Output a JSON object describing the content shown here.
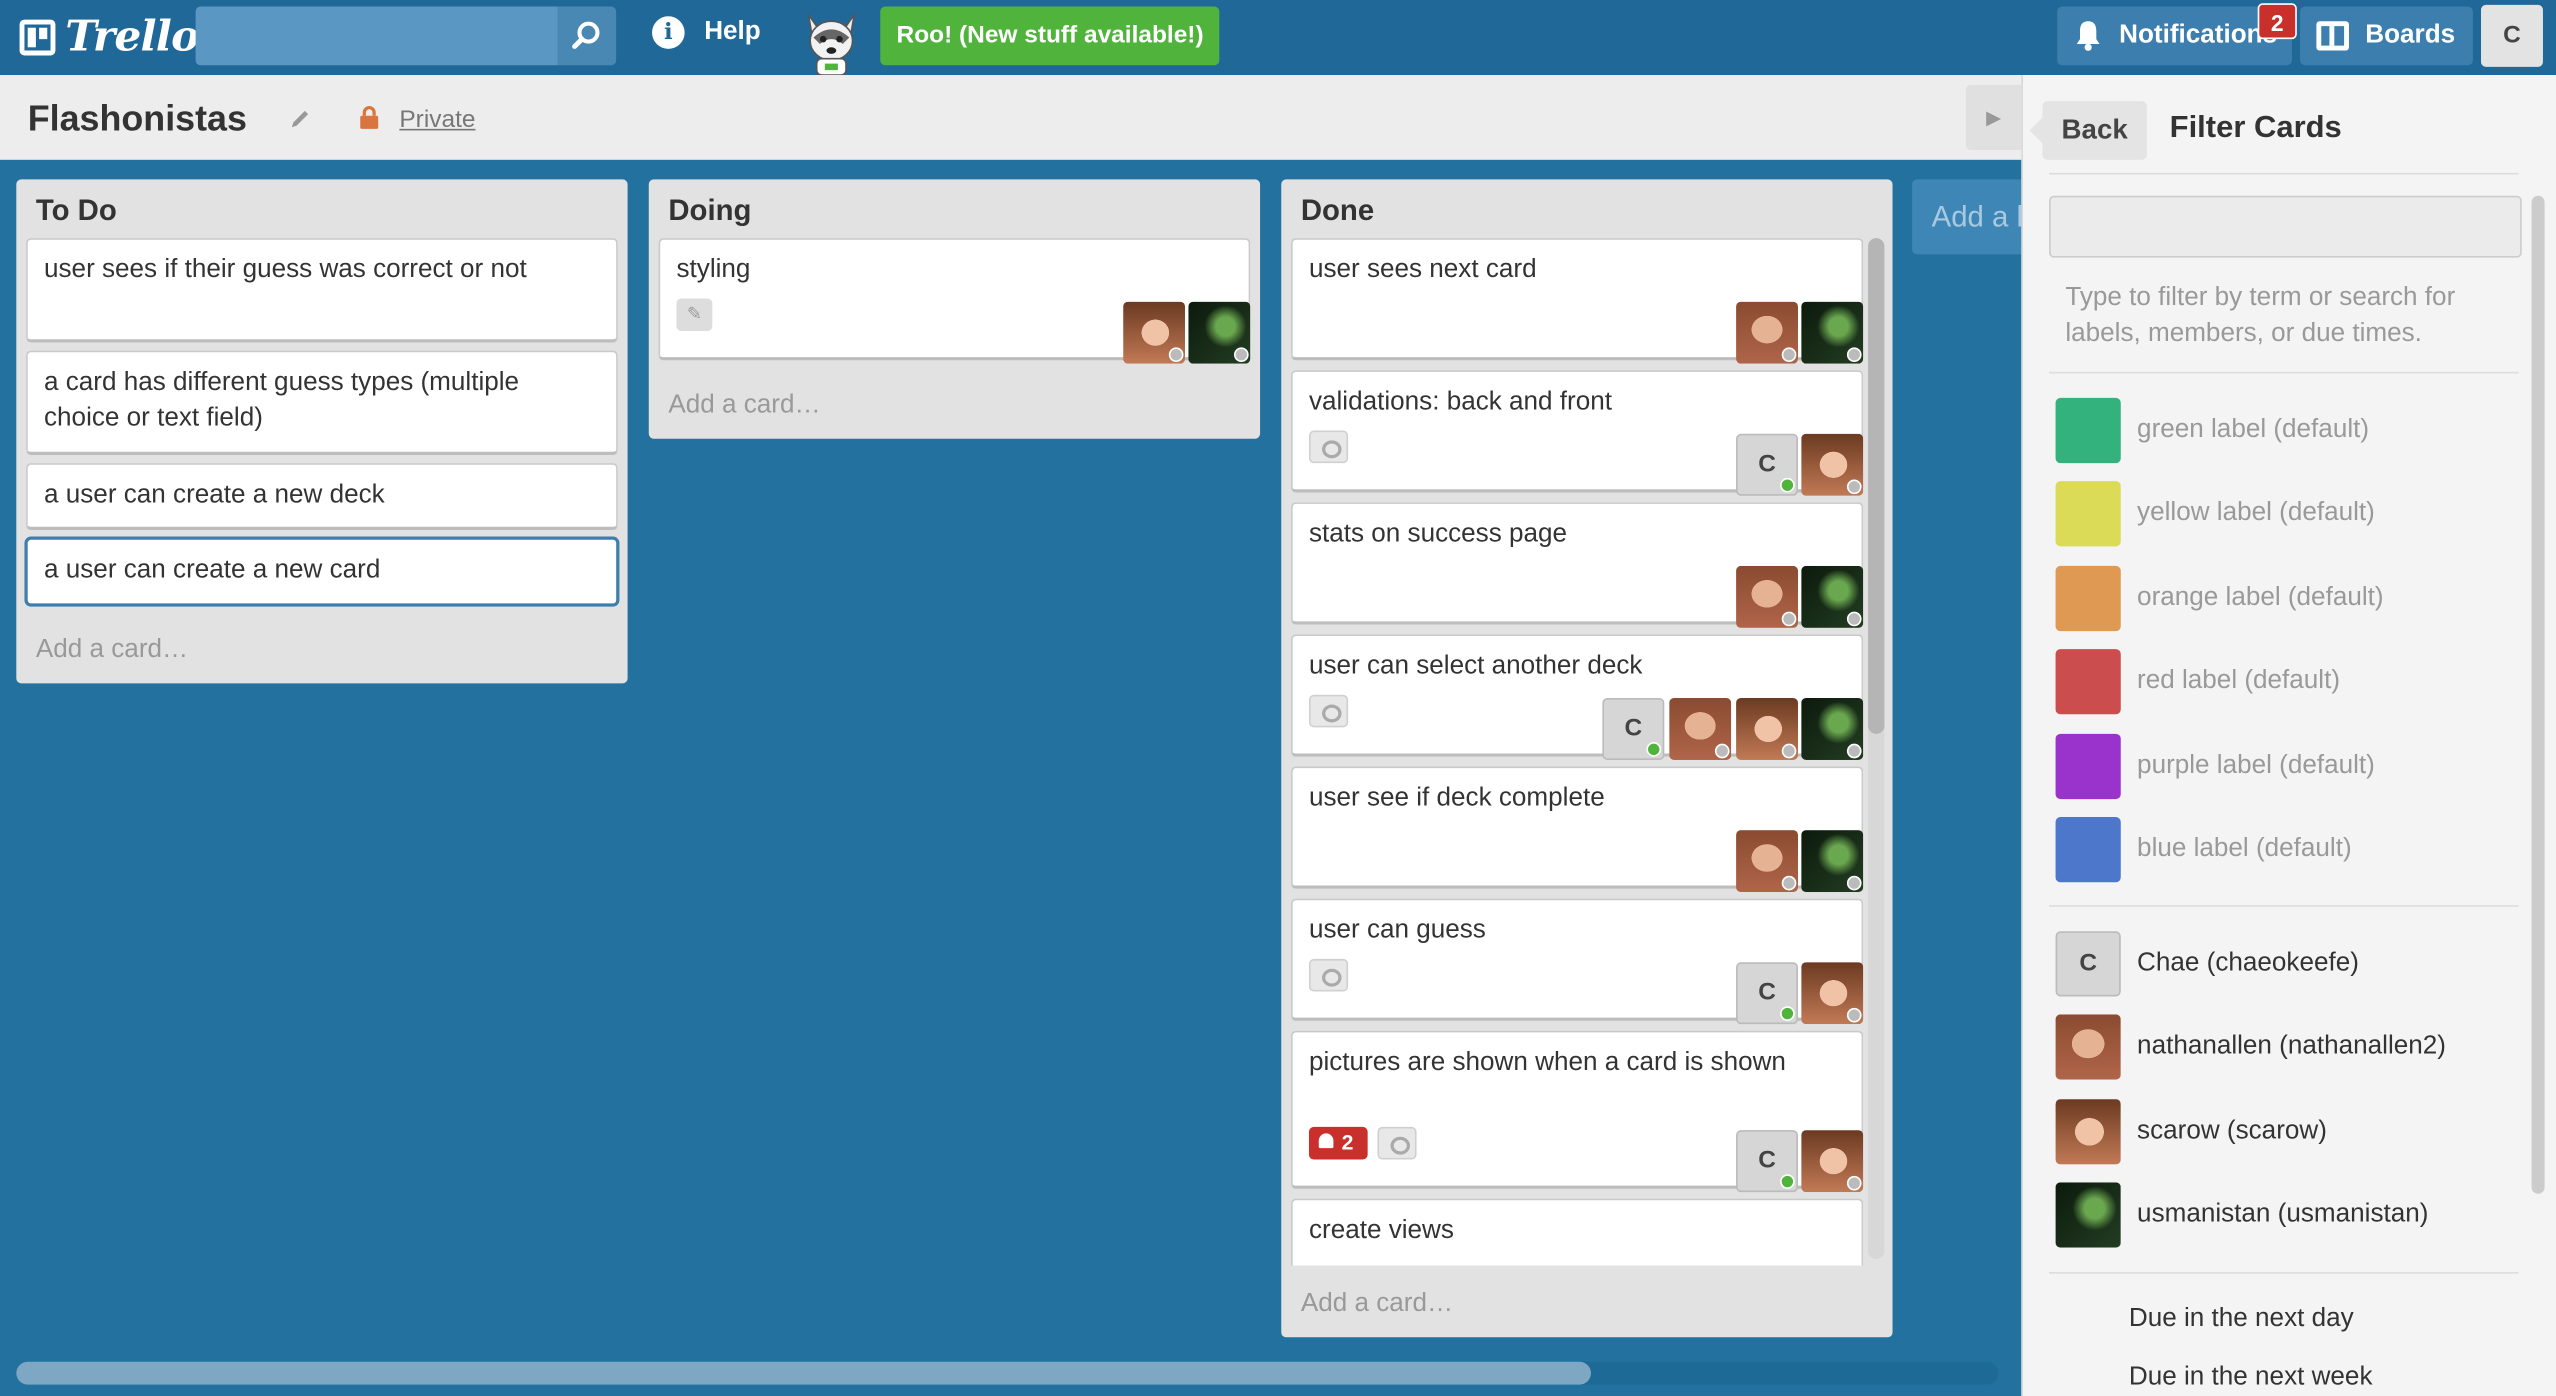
{
  "topbar": {
    "logo": "Trello",
    "search_placeholder": "",
    "help": "Help",
    "roo": "Roo! (New stuff available!)",
    "notifications": "Notifications",
    "notif_count": "2",
    "boards": "Boards",
    "user_initial": "C"
  },
  "board": {
    "title": "Flashonistas",
    "privacy": "Private"
  },
  "lists": [
    {
      "title": "To Do",
      "add": "Add a card…",
      "cards": [
        "user sees if their guess was correct or not",
        "a card has different guess types (multiple choice or text field)",
        "a user can create a new deck",
        "a user can create a new card"
      ]
    },
    {
      "title": "Doing",
      "add": "Add a card…",
      "cards": [
        "styling"
      ]
    },
    {
      "title": "Done",
      "add": "Add a card…",
      "cards": [
        "user sees next card",
        "validations: back and front",
        "stats on success page",
        "user can select another deck",
        "user see if deck complete",
        "user can guess",
        "pictures are shown when a card is shown",
        "create views"
      ]
    }
  ],
  "done_notif_badge": "2",
  "add_list": "Add a list…",
  "sidebar": {
    "back": "Back",
    "title": "Filter Cards",
    "filter_value": "",
    "help": "Type to filter by term or search for labels, members, or due times.",
    "labels": [
      {
        "name": "green label (default)",
        "color": "#34b27d"
      },
      {
        "name": "yellow label (default)",
        "color": "#dbdb57"
      },
      {
        "name": "orange label (default)",
        "color": "#e09952"
      },
      {
        "name": "red label (default)",
        "color": "#cb4d4d"
      },
      {
        "name": "purple label (default)",
        "color": "#9933cc"
      },
      {
        "name": "blue label (default)",
        "color": "#4d77cb"
      }
    ],
    "members": [
      {
        "name": "Chae (chaeokeefe)",
        "initial": "C"
      },
      {
        "name": "nathanallen (nathanallen2)"
      },
      {
        "name": "scarow (scarow)"
      },
      {
        "name": "usmanistan (usmanistan)"
      }
    ],
    "due": [
      "Due in the next day",
      "Due in the next week"
    ]
  }
}
